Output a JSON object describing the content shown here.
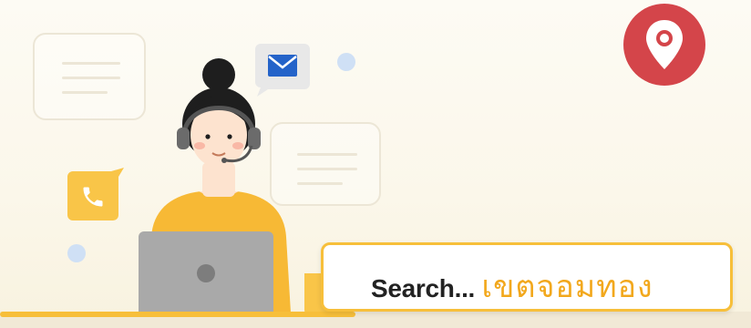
{
  "search": {
    "prefix": "Search...",
    "term": "เขตจอมทอง"
  },
  "icons": {
    "location": "map-pin-icon",
    "email": "envelope-icon",
    "phone": "phone-icon"
  },
  "colors": {
    "accent_yellow": "#f7bf3a",
    "accent_orange": "#f2a81d",
    "pin_red": "#d4454a",
    "envelope_blue": "#2463c9",
    "laptop_gray": "#a9a9a9"
  }
}
